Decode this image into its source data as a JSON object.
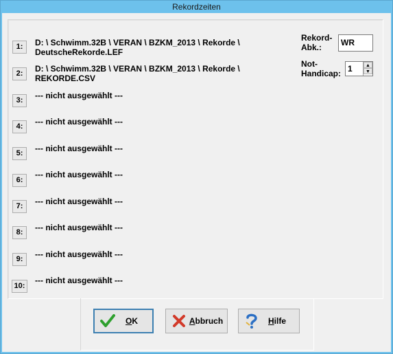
{
  "window": {
    "title": "Rekordzeiten"
  },
  "rows": [
    {
      "num": "1:",
      "line1": "D: \\ Schwimm.32B \\ VERAN \\ BZKM_2013 \\ Rekorde \\",
      "line2": "DeutscheRekorde.LEF"
    },
    {
      "num": "2:",
      "line1": "D: \\ Schwimm.32B \\ VERAN \\ BZKM_2013 \\ Rekorde \\",
      "line2": "REKORDE.CSV"
    },
    {
      "num": "3:",
      "line1": "--- nicht ausgewählt ---",
      "line2": ""
    },
    {
      "num": "4:",
      "line1": "--- nicht ausgewählt ---",
      "line2": ""
    },
    {
      "num": "5:",
      "line1": "--- nicht ausgewählt ---",
      "line2": ""
    },
    {
      "num": "6:",
      "line1": "--- nicht ausgewählt ---",
      "line2": ""
    },
    {
      "num": "7:",
      "line1": "--- nicht ausgewählt ---",
      "line2": ""
    },
    {
      "num": "8:",
      "line1": "--- nicht ausgewählt ---",
      "line2": ""
    },
    {
      "num": "9:",
      "line1": "--- nicht ausgewählt ---",
      "line2": ""
    },
    {
      "num": "10:",
      "line1": "--- nicht ausgewählt ---",
      "line2": ""
    }
  ],
  "rekord": {
    "label1": "Rekord-",
    "label2": "Abk.:",
    "value": "WR"
  },
  "handicap": {
    "label1": "Not-",
    "label2": "Handicap:",
    "value": "1"
  },
  "buttons": {
    "ok": {
      "accel": "O",
      "rest": "K",
      "icon": "checkmark-icon",
      "color": "#2ea02e"
    },
    "cancel": {
      "accel": "A",
      "rest": "bbruch",
      "icon": "cross-icon",
      "color": "#d23a2a"
    },
    "help": {
      "accel": "H",
      "rest": "ilfe",
      "icon": "question-icon",
      "color": "#2b6fc4"
    }
  }
}
